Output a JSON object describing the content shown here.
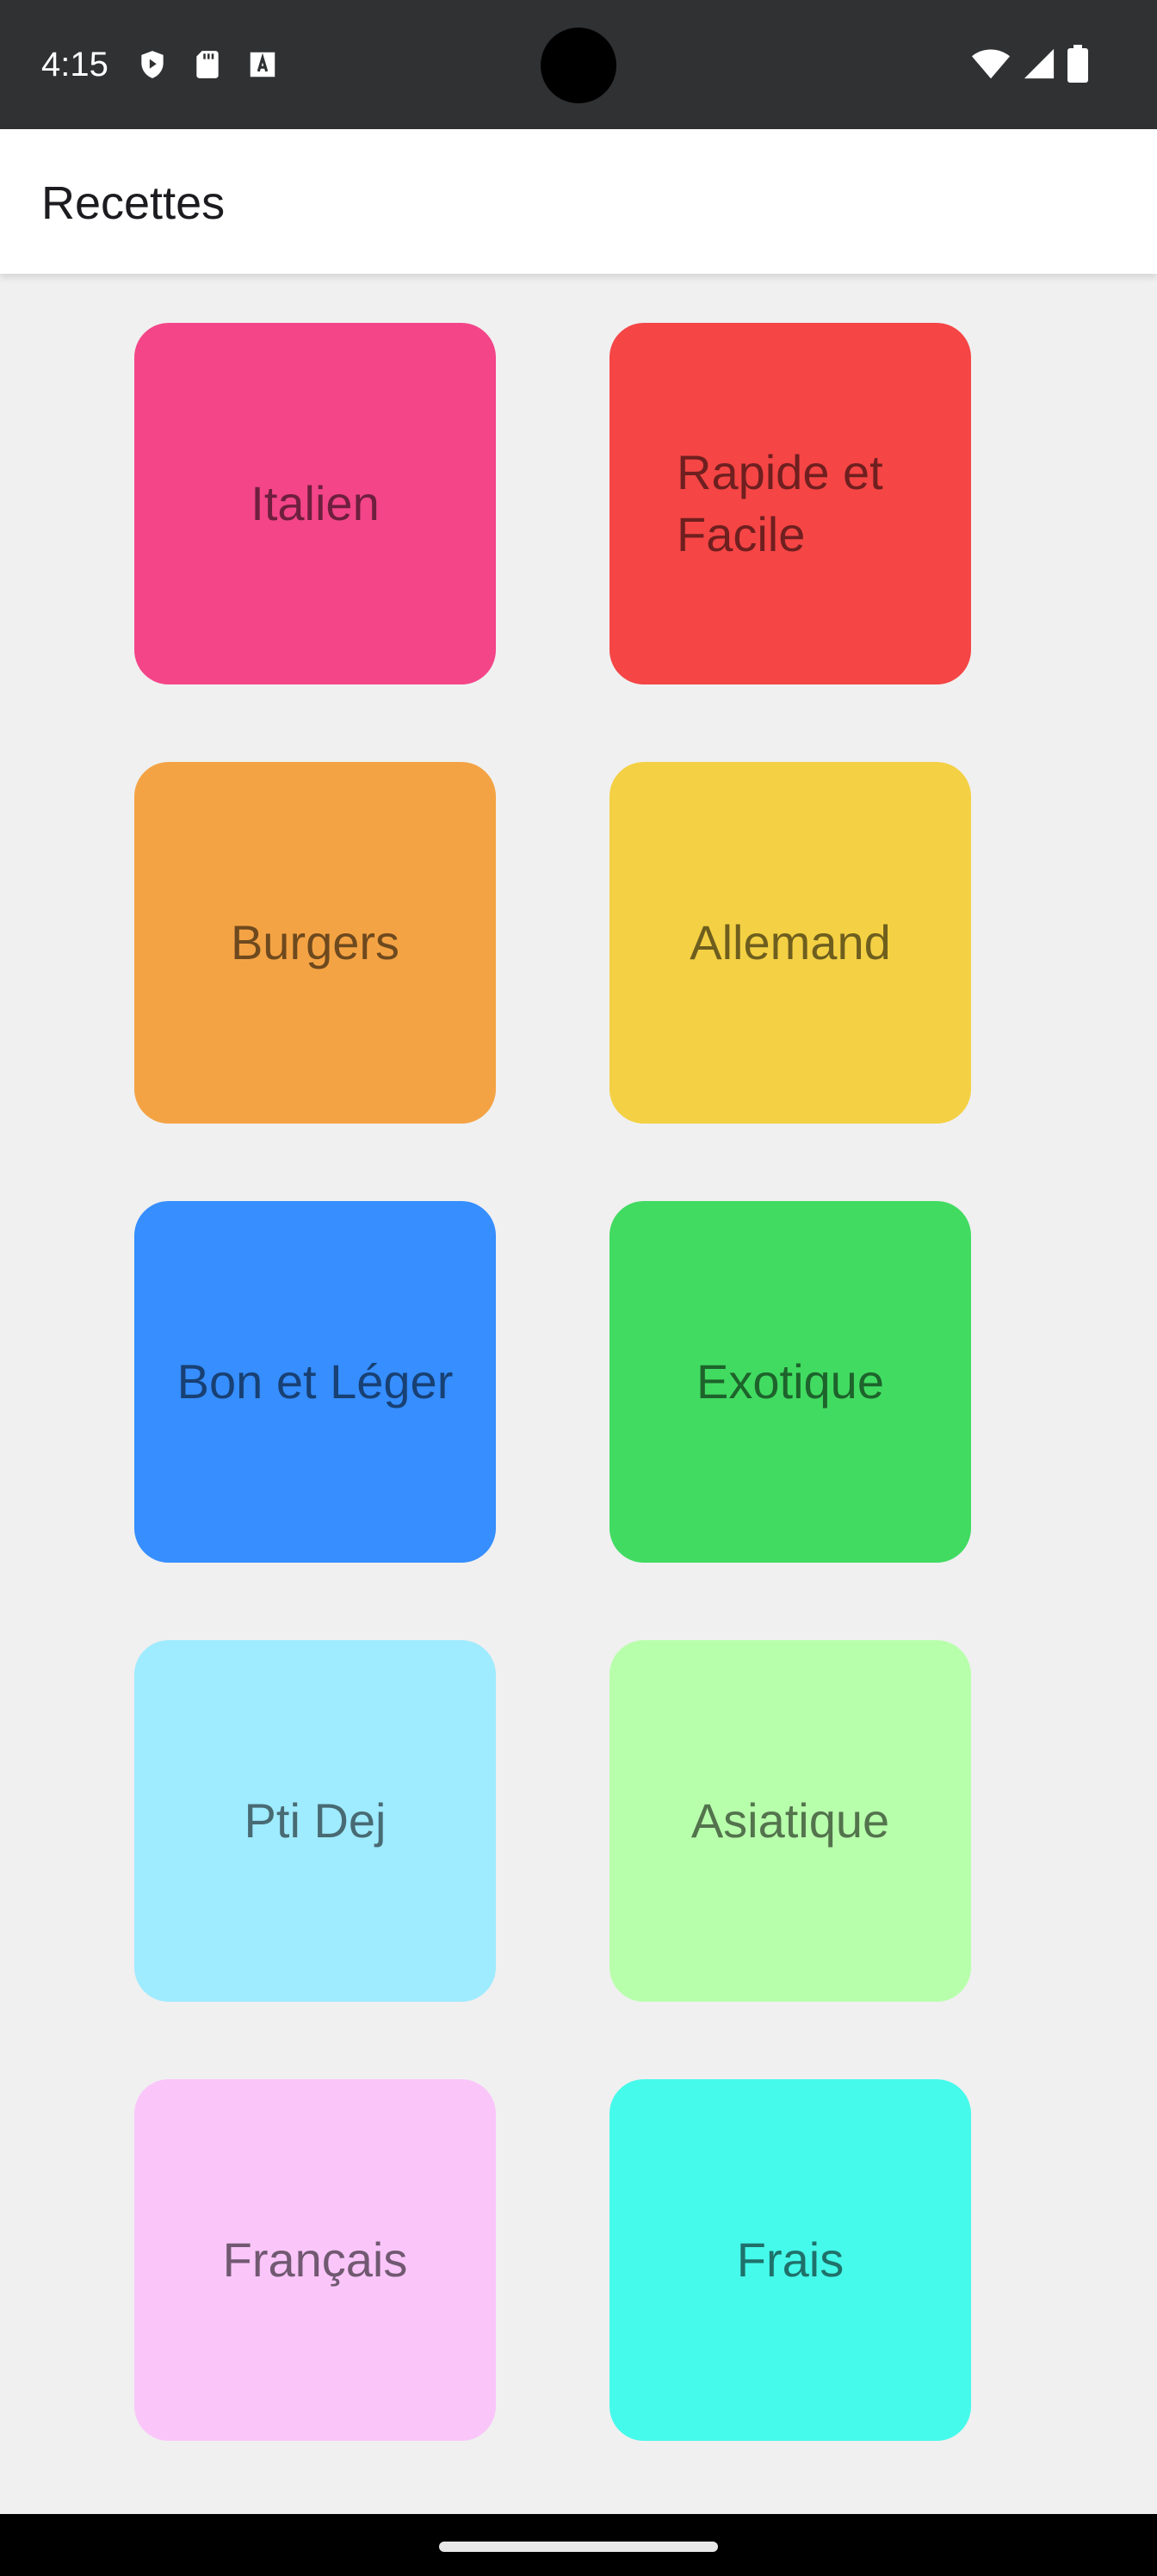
{
  "status_bar": {
    "time": "4:15",
    "left_icons": [
      "shield-play-icon",
      "sd-card-icon",
      "font-a-icon"
    ],
    "right_icons": [
      "wifi-icon",
      "signal-icon",
      "battery-icon"
    ]
  },
  "app_bar": {
    "title": "Recettes"
  },
  "categories": [
    {
      "label": "Italien",
      "color": "#F44589"
    },
    {
      "label": "Rapide et Facile",
      "color": "#F54545"
    },
    {
      "label": "Burgers",
      "color": "#F4A344"
    },
    {
      "label": "Allemand",
      "color": "#F4D044"
    },
    {
      "label": "Bon et Léger",
      "color": "#368EFF"
    },
    {
      "label": "Exotique",
      "color": "#41DB61"
    },
    {
      "label": "Pti Dej",
      "color": "#9FEBFF"
    },
    {
      "label": "Asiatique",
      "color": "#B8FFAC"
    },
    {
      "label": "Français",
      "color": "#FAC6FA"
    },
    {
      "label": "Frais",
      "color": "#45FAEB"
    }
  ]
}
